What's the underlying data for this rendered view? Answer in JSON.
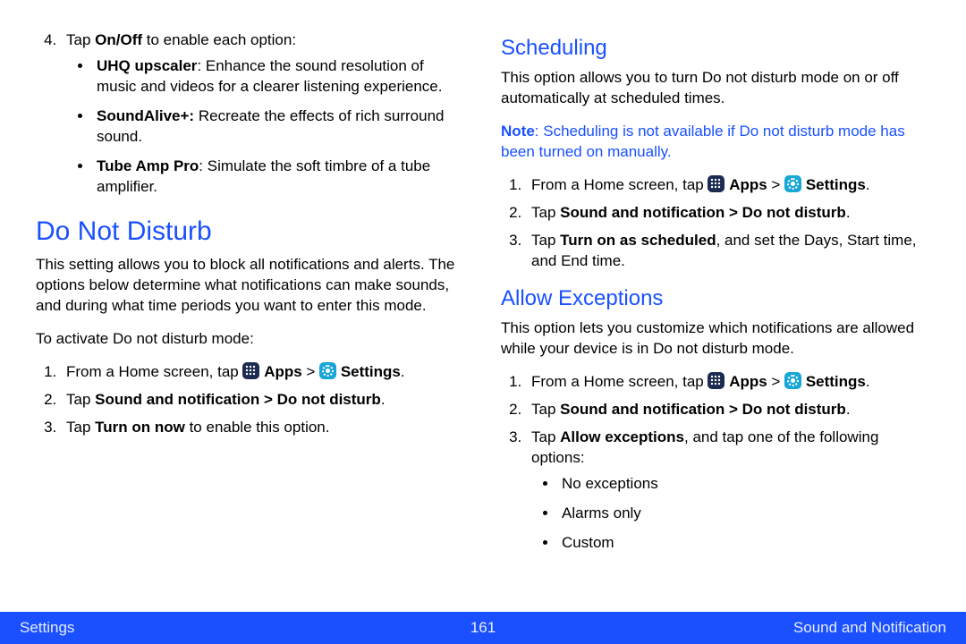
{
  "left": {
    "list_start": 4,
    "step4_prefix": "Tap ",
    "step4_bold": "On/Off",
    "step4_suffix": " to enable each option:",
    "opts": [
      {
        "name": "UHQ upscaler",
        "desc": ": Enhance the sound resolution of music and videos for a clearer listening experience."
      },
      {
        "name": "SoundAlive+:",
        "desc": " Recreate the effects of rich surround sound."
      },
      {
        "name": "Tube Amp Pro",
        "desc": ": Simulate the soft timbre of a tube amplifier."
      }
    ],
    "h1": "Do Not Disturb",
    "intro": "This setting allows you to block all notifications and alerts. The options below determine what notifications can make sounds, and during what time periods you want to enter this mode.",
    "activate": "To activate Do not disturb mode:",
    "s1_pre": "From a Home screen, tap ",
    "apps_lbl": "Apps",
    "gt": " > ",
    "settings_lbl": "Settings",
    "period": ".",
    "s2_pre": "Tap ",
    "s2_bold": "Sound and notification > Do not disturb",
    "s3_pre": "Tap ",
    "s3_bold": "Turn on now",
    "s3_post": " to enable this option."
  },
  "right": {
    "sched_h": "Scheduling",
    "sched_p": "This option allows you to turn Do not disturb mode on or off automatically at scheduled times.",
    "note_b": "Note",
    "note_rest": ": Scheduling is not available if Do not disturb mode has been turned on manually.",
    "s1_pre": "From a Home screen, tap ",
    "apps_lbl": "Apps",
    "gt": " > ",
    "settings_lbl": "Settings",
    "period": ".",
    "s2_pre": "Tap ",
    "s2_bold": "Sound and notification > Do not disturb",
    "s3_pre": "Tap ",
    "s3_bold": "Turn on as scheduled",
    "s3_post": ", and set the Days, Start time, and End time.",
    "allow_h": "Allow Exceptions",
    "allow_p": "This option lets you customize which notifications are allowed while your device is in Do not disturb mode.",
    "a3_pre": "Tap ",
    "a3_bold": "Allow exceptions",
    "a3_post": ", and tap one of the following options:",
    "exceptions": [
      "No exceptions",
      "Alarms only",
      "Custom"
    ]
  },
  "footer": {
    "left": "Settings",
    "center": "161",
    "right": "Sound and Notification"
  }
}
